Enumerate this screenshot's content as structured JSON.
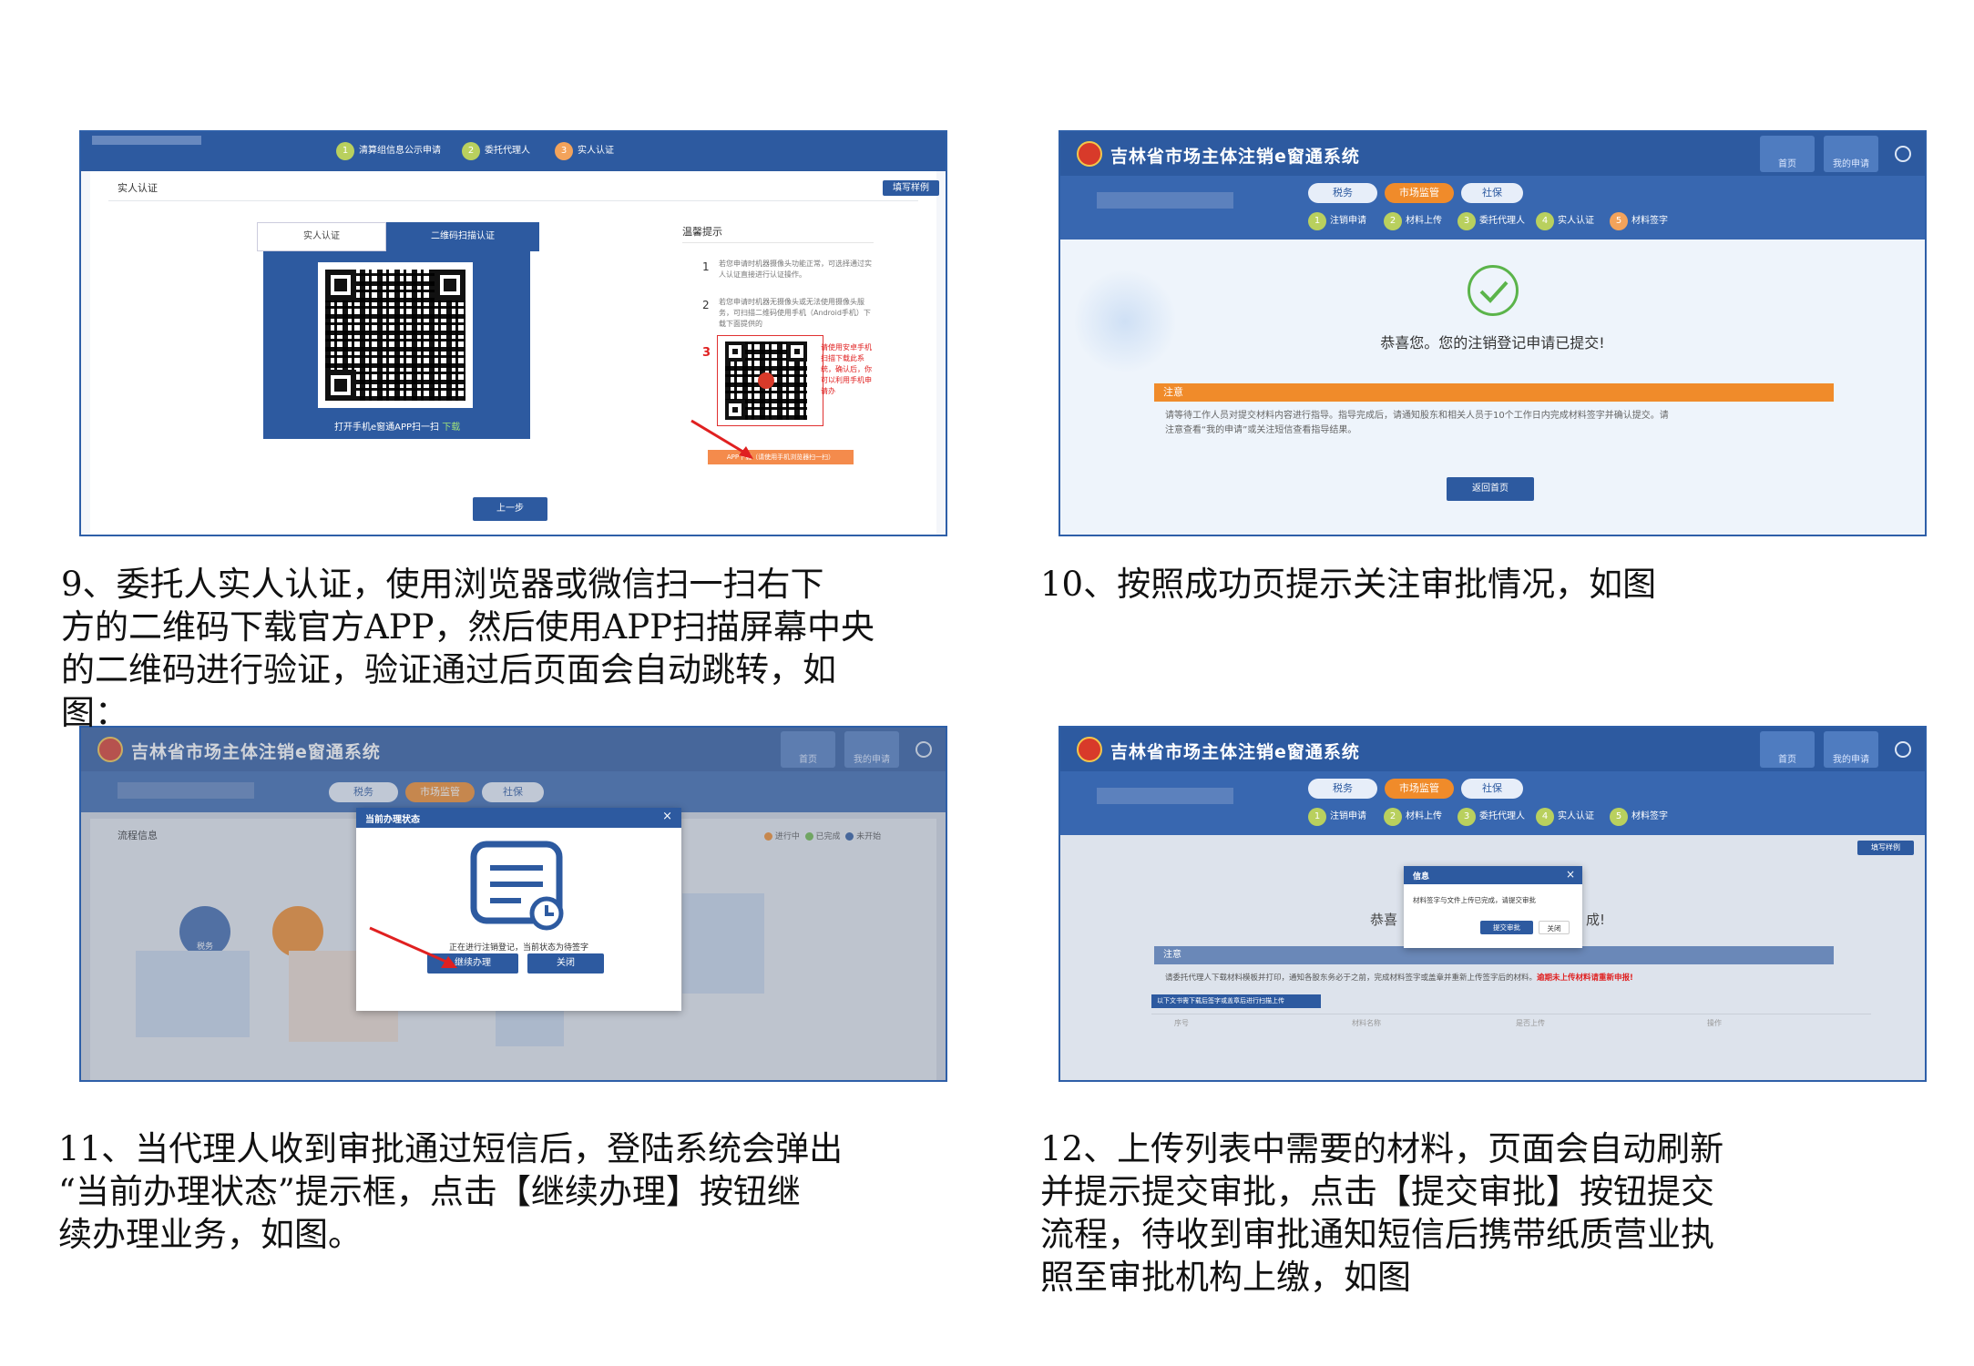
{
  "captions": {
    "c9": "9、委托人实人认证，使用浏览器或微信扫一扫右下\n方的二维码下载官方APP，然后使用APP扫描屏幕中央\n的二维码进行验证，验证通过后页面会自动跳转，如\n图：",
    "c10": "10、按照成功页提示关注审批情况，如图",
    "c11": "11、当代理人收到审批通过短信后，登陆系统会弹出\n“当前办理状态”提示框，点击【继续办理】按钮继\n续办理业务，如图。",
    "c12": "12、上传列表中需要的材料，页面会自动刷新\n并提示提交审批，点击【提交审批】按钮提交\n流程，待收到审批通知短信后携带纸质营业执\n照至审批机构上缴，如图"
  },
  "system": {
    "title": "吉林省市场主体注销e窗通系统",
    "home_btn": "首页",
    "my_apply_btn": "我的申请",
    "tabs": [
      "税务",
      "市场监管",
      "社保"
    ]
  },
  "shot9": {
    "steps": [
      "清算组信息公示申请",
      "委托代理人",
      "实人认证"
    ],
    "step_nums": [
      "1",
      "2",
      "3"
    ],
    "section_title": "实人认证",
    "sample_btn": "填写样例",
    "tab_real": "实人认证",
    "tab_qr": "二维码扫描认证",
    "qr_hint": "打开手机e窗通APP扫一扫",
    "qr_hint_link": "下载",
    "tips_title": "温馨提示",
    "tip1_num": "1",
    "tip1": "若您申请时机器摄像头功能正常，可选择通过实人认证直接进行认证操作。",
    "tip2_num": "2",
    "tip2": "若您申请时机器无摄像头或无法使用摄像头服务，可扫描二维码使用手机（Android手机）下载下面提供的",
    "tip3_num": "3",
    "app_side": "请使用安卓手机扫描下载此系统，确认后，你可以利用手机申请办",
    "app_download": "APP下载（请使用手机浏览器扫一扫）",
    "prev_btn": "上一步"
  },
  "shot10": {
    "steps": [
      "注销申请",
      "材料上传",
      "委托代理人",
      "实人认证",
      "材料签字"
    ],
    "step_nums": [
      "1",
      "2",
      "3",
      "4",
      "5"
    ],
    "congrats": "恭喜您。您的注销登记申请已提交!",
    "notice_title": "注意",
    "notice_text1": "请等待工作人员对提交材料内容进行指导。指导完成后，请通知股东和相关人员于10个工作日内完成材料签字并确认提交。请",
    "notice_text2": "注意查看“我的申请”或关注短信查看指导结果。",
    "return_btn": "返回首页"
  },
  "shot11": {
    "flow_title": "流程信息",
    "legend": [
      "进行中",
      "已完成",
      "未开始"
    ],
    "dialog_title": "当前办理状态",
    "dialog_msg": "正在进行注销登记，当前状态为待签字",
    "continue_btn": "继续办理",
    "close_btn": "关闭",
    "node_tax": "税务",
    "node_social": "社保"
  },
  "shot12": {
    "steps": [
      "注销申请",
      "材料上传",
      "委托代理人",
      "实人认证",
      "材料签字"
    ],
    "step_nums": [
      "1",
      "2",
      "3",
      "4",
      "5"
    ],
    "sample_btn": "填写样例",
    "dialog_title": "信息",
    "dialog_msg": "材料签字与文件上传已完成，请提交审批",
    "submit_btn": "提交审批",
    "close_btn": "关闭",
    "congrats_left": "恭喜",
    "congrats_right": "成!",
    "notice_title": "注意",
    "notice_text": "请委托代理人下载材料模板并打印，通知各股东务必于之前，完成材料签字或盖章并重新上传签字后的材料。",
    "notice_warn": "逾期未上传材料请重新申报!",
    "upload_bar": "以下文书需下载后签字或盖章后进行扫描上传",
    "table_headers": [
      "序号",
      "材料名称",
      "是否上传",
      "操作"
    ]
  },
  "colors": {
    "brand": "#2d5aa0",
    "orange": "#f08b2a",
    "green": "#6cb84a"
  }
}
